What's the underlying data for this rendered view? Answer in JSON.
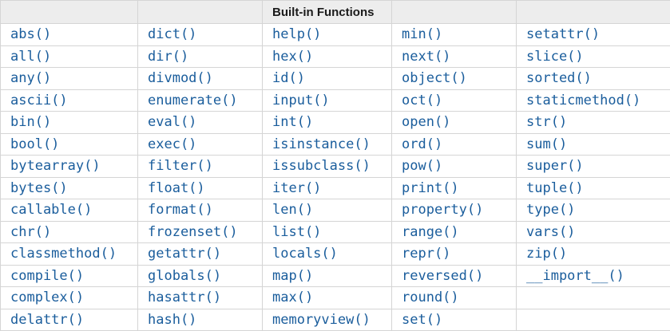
{
  "table": {
    "title": "Built-in Functions",
    "header": {
      "cells": [
        "",
        "",
        "Built-in Functions",
        "",
        ""
      ]
    },
    "columns": [
      [
        "abs()",
        "all()",
        "any()",
        "ascii()",
        "bin()",
        "bool()",
        "bytearray()",
        "bytes()",
        "callable()",
        "chr()",
        "classmethod()",
        "compile()",
        "complex()",
        "delattr()"
      ],
      [
        "dict()",
        "dir()",
        "divmod()",
        "enumerate()",
        "eval()",
        "exec()",
        "filter()",
        "float()",
        "format()",
        "frozenset()",
        "getattr()",
        "globals()",
        "hasattr()",
        "hash()"
      ],
      [
        "help()",
        "hex()",
        "id()",
        "input()",
        "int()",
        "isinstance()",
        "issubclass()",
        "iter()",
        "len()",
        "list()",
        "locals()",
        "map()",
        "max()",
        "memoryview()"
      ],
      [
        "min()",
        "next()",
        "object()",
        "oct()",
        "open()",
        "ord()",
        "pow()",
        "print()",
        "property()",
        "range()",
        "repr()",
        "reversed()",
        "round()",
        "set()"
      ],
      [
        "setattr()",
        "slice()",
        "sorted()",
        "staticmethod()",
        "str()",
        "sum()",
        "super()",
        "tuple()",
        "type()",
        "vars()",
        "zip()",
        "__import__()",
        "",
        ""
      ]
    ]
  },
  "colors": {
    "link": "#1a5d9c",
    "header_bg": "#ededed",
    "border": "#d5d5d5",
    "outer_border": "#cfcfcf",
    "header_text": "#1a1a1a",
    "row_bg": "#ffffff"
  }
}
